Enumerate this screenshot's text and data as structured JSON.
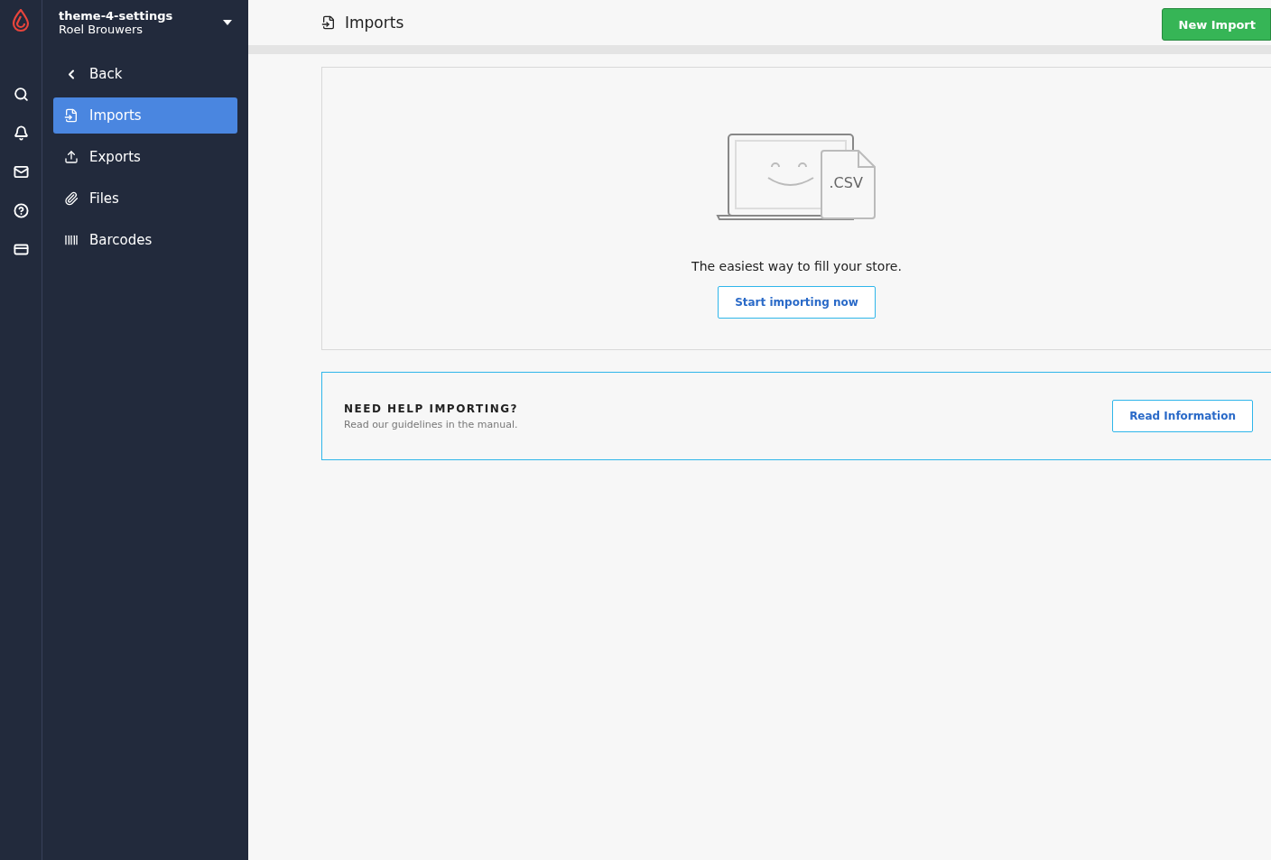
{
  "account": {
    "shop": "theme-4-settings",
    "user": "Roel Brouwers"
  },
  "nav": {
    "back": "Back",
    "items": [
      {
        "label": "Imports",
        "selected": true
      },
      {
        "label": "Exports",
        "selected": false
      },
      {
        "label": "Files",
        "selected": false
      },
      {
        "label": "Barcodes",
        "selected": false
      }
    ]
  },
  "header": {
    "title": "Imports",
    "action": "New Import"
  },
  "empty_state": {
    "file_label": ".CSV",
    "message": "The easiest way to fill your store.",
    "button": "Start importing now"
  },
  "help": {
    "title": "NEED HELP IMPORTING?",
    "text": "Read our guidelines in the manual.",
    "button": "Read Information"
  }
}
